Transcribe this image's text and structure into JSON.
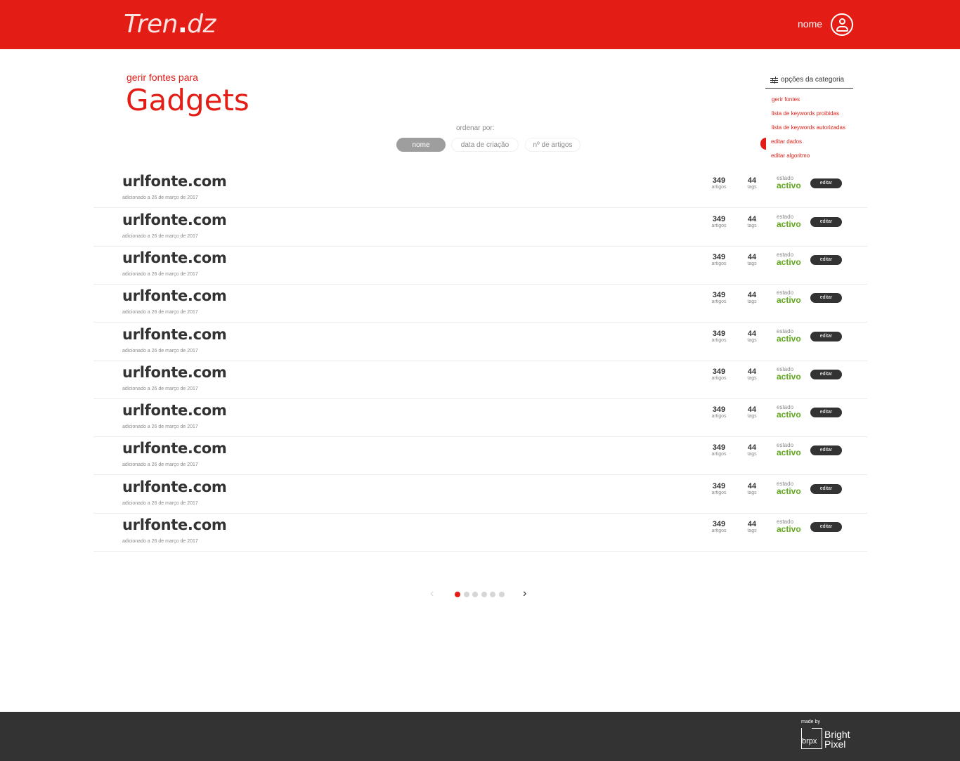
{
  "header": {
    "logo_main": "Tren",
    "logo_dot": ".",
    "logo_end": "dz",
    "user_name": "nome"
  },
  "page": {
    "subtitle": "gerir fontes para",
    "title": "Gadgets"
  },
  "sort": {
    "label": "ordenar por:",
    "options": [
      "nome",
      "data de criação",
      "nº de artigos"
    ],
    "active": "nome"
  },
  "options_menu": {
    "title": "opções da categoria",
    "items": [
      "gerir fontes",
      "lista de keywords proibidas",
      "lista de keywords autorizadas",
      "editar dados",
      "editar algoritmo"
    ]
  },
  "sources": [
    {
      "url": "urlfonte.com",
      "added": "adicionado a 26 de março de 2017",
      "articles": "349",
      "articles_label": "artigos",
      "tags": "44",
      "tags_label": "tags",
      "status_label": "estado",
      "status": "activo",
      "edit": "editar"
    },
    {
      "url": "urlfonte.com",
      "added": "adicionado a 26 de março de 2017",
      "articles": "349",
      "articles_label": "artigos",
      "tags": "44",
      "tags_label": "tags",
      "status_label": "estado",
      "status": "activo",
      "edit": "editar"
    },
    {
      "url": "urlfonte.com",
      "added": "adicionado a 26 de março de 2017",
      "articles": "349",
      "articles_label": "artigos",
      "tags": "44",
      "tags_label": "tags",
      "status_label": "estado",
      "status": "activo",
      "edit": "editar"
    },
    {
      "url": "urlfonte.com",
      "added": "adicionado a 26 de março de 2017",
      "articles": "349",
      "articles_label": "artigos",
      "tags": "44",
      "tags_label": "tags",
      "status_label": "estado",
      "status": "activo",
      "edit": "editar"
    },
    {
      "url": "urlfonte.com",
      "added": "adicionado a 26 de março de 2017",
      "articles": "349",
      "articles_label": "artigos",
      "tags": "44",
      "tags_label": "tags",
      "status_label": "estado",
      "status": "activo",
      "edit": "editar"
    },
    {
      "url": "urlfonte.com",
      "added": "adicionado a 26 de março de 2017",
      "articles": "349",
      "articles_label": "artigos",
      "tags": "44",
      "tags_label": "tags",
      "status_label": "estado",
      "status": "activo",
      "edit": "editar"
    },
    {
      "url": "urlfonte.com",
      "added": "adicionado a 26 de março de 2017",
      "articles": "349",
      "articles_label": "artigos",
      "tags": "44",
      "tags_label": "tags",
      "status_label": "estado",
      "status": "activo",
      "edit": "editar"
    },
    {
      "url": "urlfonte.com",
      "added": "adicionado a 26 de março de 2017",
      "articles": "349",
      "articles_label": "artigos",
      "tags": "44",
      "tags_label": "tags",
      "status_label": "estado",
      "status": "activo",
      "edit": "editar"
    },
    {
      "url": "urlfonte.com",
      "added": "adicionado a 26 de março de 2017",
      "articles": "349",
      "articles_label": "artigos",
      "tags": "44",
      "tags_label": "tags",
      "status_label": "estado",
      "status": "activo",
      "edit": "editar"
    },
    {
      "url": "urlfonte.com",
      "added": "adicionado a 26 de março de 2017",
      "articles": "349",
      "articles_label": "artigos",
      "tags": "44",
      "tags_label": "tags",
      "status_label": "estado",
      "status": "activo",
      "edit": "editar"
    }
  ],
  "pagination": {
    "prev": "‹",
    "next": "›",
    "current_page": 1,
    "total_pages": 6
  },
  "footer": {
    "made_by": "made by",
    "brpx": "brpx",
    "brand_line1": "Bright",
    "brand_line2": "Pixel"
  },
  "colors": {
    "accent": "#e31c15",
    "status_active": "#5fa919",
    "dark": "#333333"
  }
}
